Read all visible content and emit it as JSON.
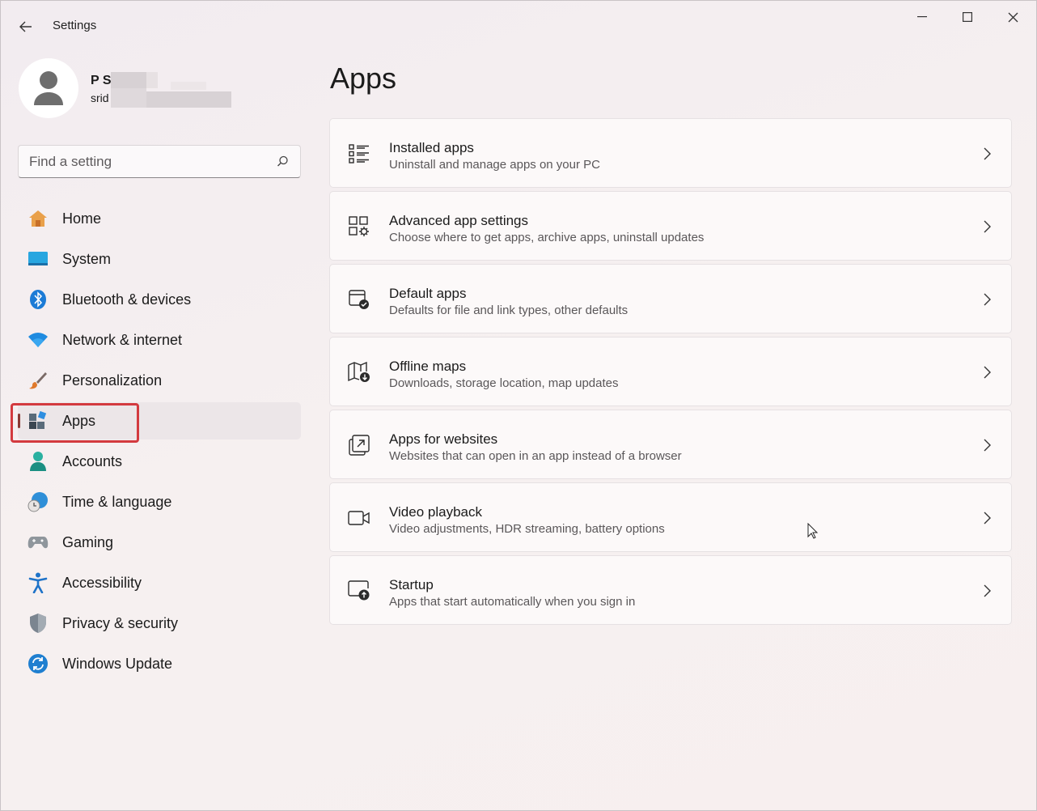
{
  "window": {
    "title": "Settings"
  },
  "profile": {
    "name": "P S",
    "email": "srid"
  },
  "search": {
    "placeholder": "Find a setting"
  },
  "sidebar": {
    "items": [
      {
        "label": "Home",
        "icon": "home-icon"
      },
      {
        "label": "System",
        "icon": "system-icon"
      },
      {
        "label": "Bluetooth & devices",
        "icon": "bluetooth-icon"
      },
      {
        "label": "Network & internet",
        "icon": "wifi-icon"
      },
      {
        "label": "Personalization",
        "icon": "brush-icon"
      },
      {
        "label": "Apps",
        "icon": "apps-icon",
        "selected": true
      },
      {
        "label": "Accounts",
        "icon": "account-icon"
      },
      {
        "label": "Time & language",
        "icon": "clock-globe-icon"
      },
      {
        "label": "Gaming",
        "icon": "gamepad-icon"
      },
      {
        "label": "Accessibility",
        "icon": "accessibility-icon"
      },
      {
        "label": "Privacy & security",
        "icon": "shield-icon"
      },
      {
        "label": "Windows Update",
        "icon": "update-icon"
      }
    ]
  },
  "main": {
    "title": "Apps",
    "cards": [
      {
        "title": "Installed apps",
        "description": "Uninstall and manage apps on your PC",
        "icon": "list-icon"
      },
      {
        "title": "Advanced app settings",
        "description": "Choose where to get apps, archive apps, uninstall updates",
        "icon": "app-settings-icon"
      },
      {
        "title": "Default apps",
        "description": "Defaults for file and link types, other defaults",
        "icon": "default-apps-icon"
      },
      {
        "title": "Offline maps",
        "description": "Downloads, storage location, map updates",
        "icon": "map-download-icon"
      },
      {
        "title": "Apps for websites",
        "description": "Websites that can open in an app instead of a browser",
        "icon": "open-in-app-icon"
      },
      {
        "title": "Video playback",
        "description": "Video adjustments, HDR streaming, battery options",
        "icon": "video-icon"
      },
      {
        "title": "Startup",
        "description": "Apps that start automatically when you sign in",
        "icon": "startup-icon"
      }
    ]
  },
  "colors": {
    "accent": "#8a3a34",
    "highlight": "#d33a3f"
  }
}
